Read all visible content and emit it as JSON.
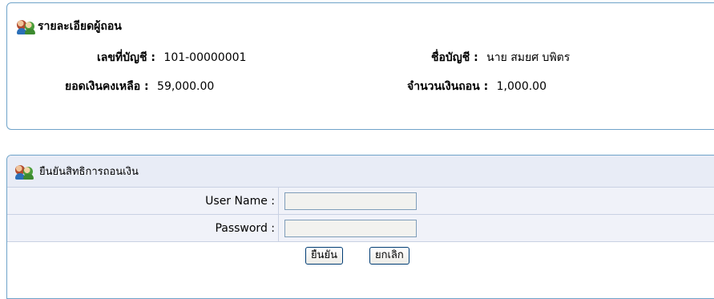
{
  "details": {
    "title": "รายละเอียดผู้ถอน",
    "account_no_label": "เลขที่บัญชี :",
    "account_no": "101-00000001",
    "account_name_label": "ชื่อบัญชี :",
    "account_name": "นาย สมยศ บพิตร",
    "balance_label": "ยอดเงินคงเหลือ :",
    "balance": "59,000.00",
    "withdraw_label": "จำนวนเงินถอน :",
    "withdraw_amount": "1,000.00"
  },
  "confirm": {
    "title": "ยืนยันสิทธิการถอนเงิน",
    "username_label": "User Name :",
    "username_value": "",
    "password_label": "Password :",
    "password_value": "",
    "confirm_button": "ยืนยัน",
    "cancel_button": "ยกเลิก"
  },
  "icons": {
    "section_icon": "users-icon"
  }
}
